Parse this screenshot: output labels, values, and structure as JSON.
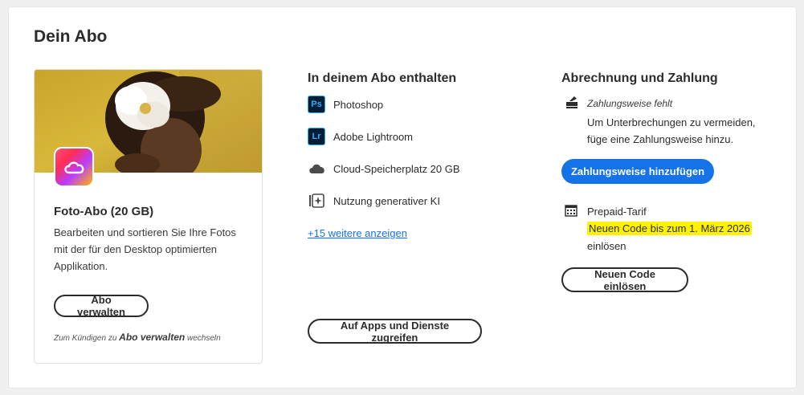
{
  "page": {
    "title": "Dein Abo"
  },
  "plan": {
    "name": "Foto-Abo (20 GB)",
    "description": "Bearbeiten und sortieren Sie Ihre Fotos mit der für den Desktop optimierten Applikation.",
    "manage_label": "Abo verwalten",
    "cancel_prefix": "Zum Kündigen zu",
    "cancel_link": "Abo verwalten",
    "cancel_suffix": "wechseln",
    "logo_icon": "creative-cloud-icon"
  },
  "included": {
    "heading": "In deinem Abo enthalten",
    "items": [
      {
        "label": "Photoshop",
        "icon": "photoshop-icon",
        "abbr": "Ps"
      },
      {
        "label": "Adobe Lightroom",
        "icon": "lightroom-icon",
        "abbr": "Lr"
      },
      {
        "label": "Cloud-Speicherplatz 20 GB",
        "icon": "cloud-icon"
      },
      {
        "label": "Nutzung generativer KI",
        "icon": "generative-ai-icon"
      }
    ],
    "more_link": "+15 weitere anzeigen",
    "apps_button": "Auf Apps und Dienste zugreifen"
  },
  "billing": {
    "heading": "Abrechnung und Zahlung",
    "payment_missing": "Zahlungsweise fehlt",
    "payment_missing_desc": "Um Unterbrechungen zu vermeiden, füge eine Zahlungsweise hinzu.",
    "add_payment_button": "Zahlungsweise hinzufügen",
    "prepaid_label": "Prepaid-Tarif",
    "redeem_highlight": "Neuen Code bis zum 1. März 2026",
    "redeem_after": "einlösen",
    "redeem_button": "Neuen Code einlösen"
  },
  "colors": {
    "accent": "#1473e6",
    "highlight": "#fff200"
  }
}
